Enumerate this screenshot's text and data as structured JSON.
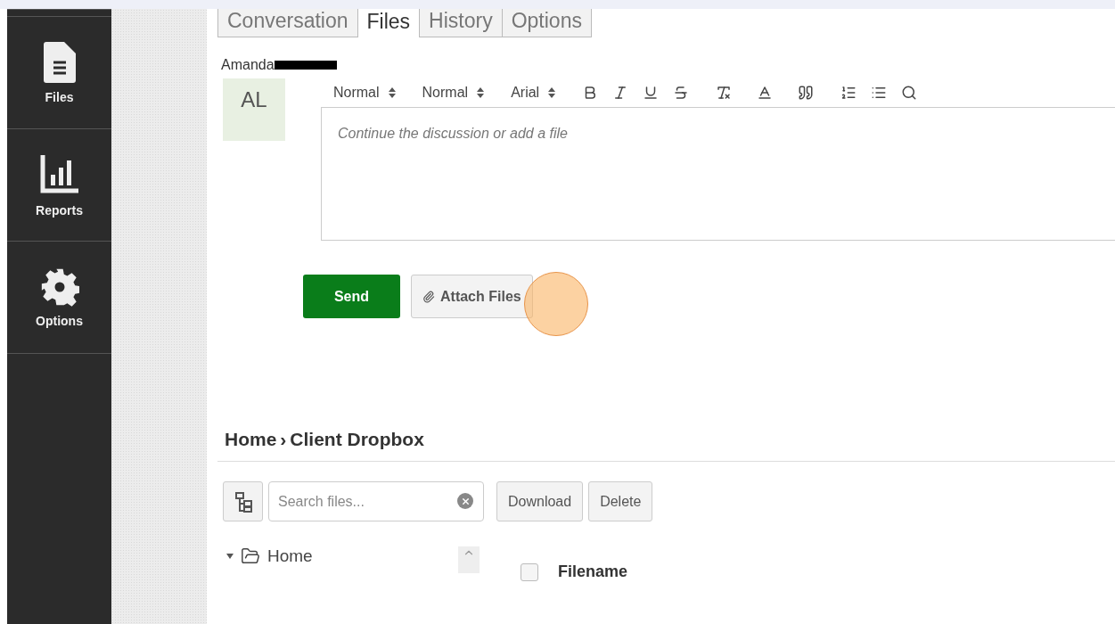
{
  "sidebar": {
    "items": [
      {
        "label": "Files",
        "selected": false
      },
      {
        "label": "Reports",
        "selected": false
      },
      {
        "label": "Options",
        "selected": false
      }
    ]
  },
  "tabs": [
    {
      "label": "Conversation",
      "selected": false
    },
    {
      "label": "Files",
      "selected": true
    },
    {
      "label": "History",
      "selected": false
    },
    {
      "label": "Options",
      "selected": false
    }
  ],
  "author": {
    "name": "Amanda",
    "redacted": true
  },
  "avatar": {
    "initials": "AL"
  },
  "editor": {
    "selects": [
      "Normal",
      "Normal",
      "Arial"
    ],
    "placeholder": "Continue the discussion or add a file"
  },
  "actions": {
    "send": "Send",
    "attach": "Attach Files",
    "click_highlight": true
  },
  "breadcrumb": {
    "home": "Home",
    "separator": "›",
    "current": "Client Dropbox"
  },
  "file_toolbar": {
    "search_placeholder": "Search files...",
    "buttons": [
      "Download",
      "Delete"
    ]
  },
  "tree": {
    "items": [
      {
        "label": "Home",
        "expanded": true
      }
    ]
  },
  "table": {
    "columns": [
      {
        "label": "Filename",
        "checked": false
      }
    ]
  }
}
